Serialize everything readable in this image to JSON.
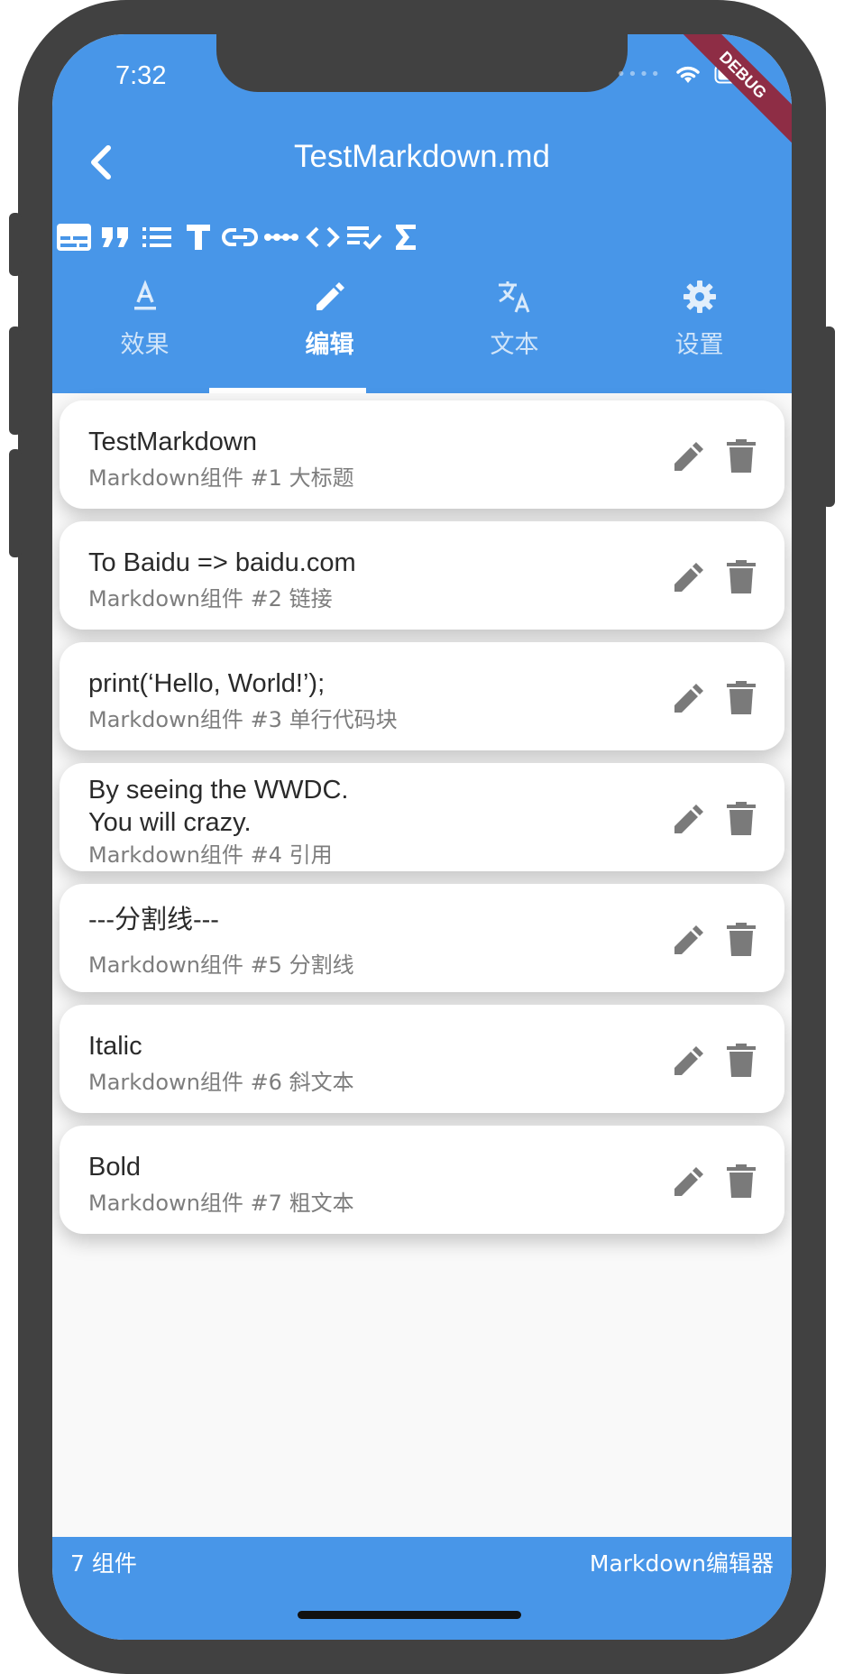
{
  "status": {
    "time": "7:32",
    "debug_label": "DEBUG"
  },
  "appbar": {
    "title": "TestMarkdown.md",
    "back_icon": "back-arrow-icon"
  },
  "toolbar": {
    "icons": [
      "subtitles-icon",
      "quote-icon",
      "list-icon",
      "text-icon",
      "link-icon",
      "divider-icon",
      "code-icon",
      "checklist-icon",
      "sigma-icon"
    ]
  },
  "tabs": [
    {
      "label": "效果",
      "icon": "text-format-icon"
    },
    {
      "label": "编辑",
      "icon": "pencil-icon"
    },
    {
      "label": "文本",
      "icon": "translate-icon"
    },
    {
      "label": "设置",
      "icon": "gear-icon"
    }
  ],
  "active_tab": 1,
  "items": [
    {
      "title": "TestMarkdown",
      "subtitle": "Markdown组件 #1 大标题"
    },
    {
      "title": "To Baidu => baidu.com",
      "subtitle": "Markdown组件 #2 链接"
    },
    {
      "title": "print(‘Hello, World!’);",
      "subtitle": "Markdown组件 #3 单行代码块"
    },
    {
      "title": "By seeing the WWDC.\nYou will crazy.",
      "subtitle": "Markdown组件 #4 引用"
    },
    {
      "title": "---分割线---",
      "subtitle": "Markdown组件 #5 分割线"
    },
    {
      "title": "Italic",
      "subtitle": "Markdown组件 #6 斜文本"
    },
    {
      "title": "Bold",
      "subtitle": "Markdown组件 #7 粗文本"
    }
  ],
  "bottom": {
    "count_label": "7 组件",
    "app_name": "Markdown编辑器"
  },
  "colors": {
    "primary": "#4896e8",
    "frame": "#414141",
    "debug": "#8e2d45",
    "icon_gray": "#7a7a7a"
  }
}
